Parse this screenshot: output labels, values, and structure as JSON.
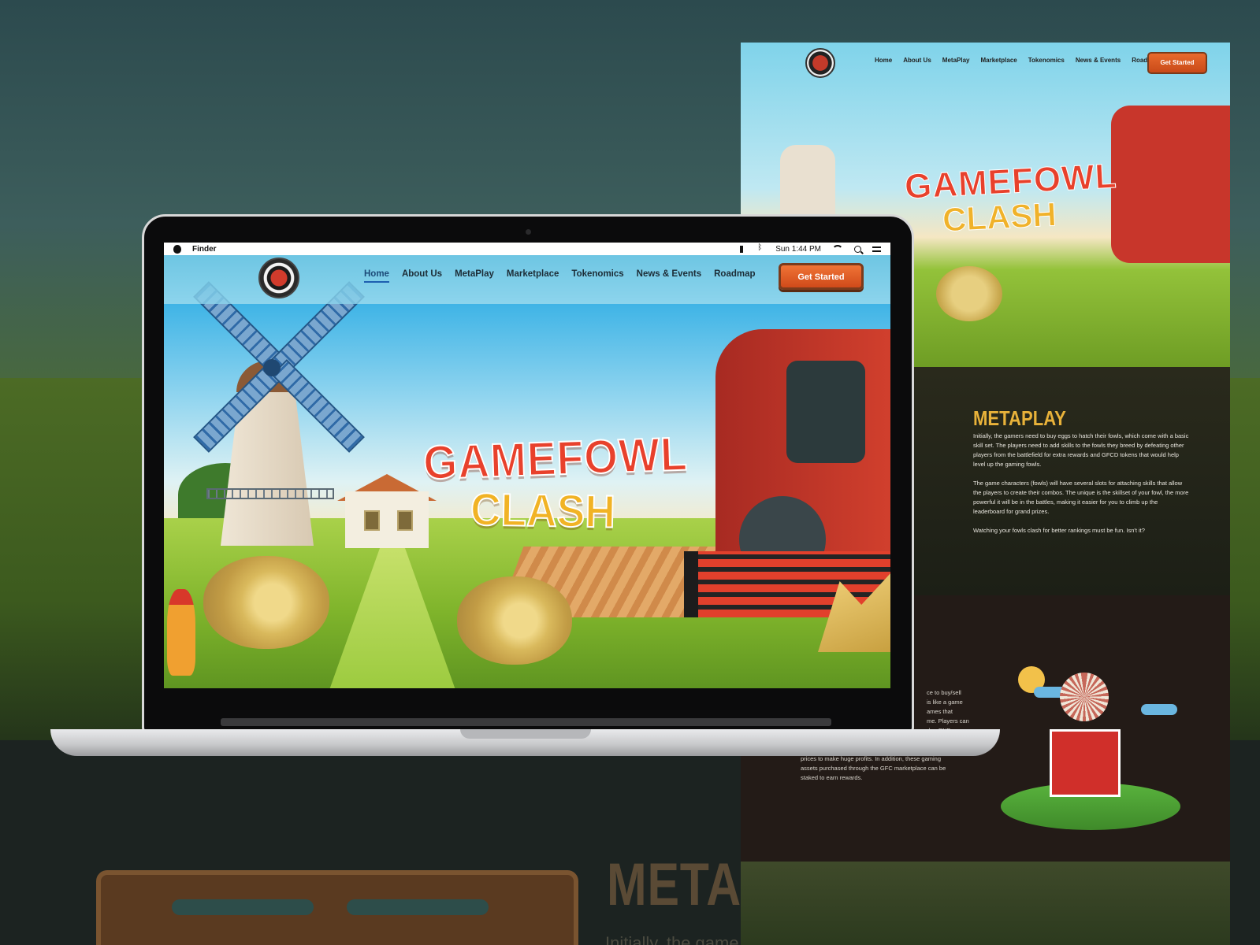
{
  "laptop": {
    "menubar": {
      "app_name": "Finder",
      "clock": "Sun 1:44 PM"
    },
    "site": {
      "nav": [
        {
          "label": "Home",
          "active": true
        },
        {
          "label": "About Us"
        },
        {
          "label": "MetaPlay"
        },
        {
          "label": "Marketplace"
        },
        {
          "label": "Tokenomics"
        },
        {
          "label": "News & Events"
        },
        {
          "label": "Roadmap"
        }
      ],
      "cta_label": "Get Started",
      "hero_title_line1": "GAMEFOWL",
      "hero_title_line2": "CLASH"
    }
  },
  "preview": {
    "nav": [
      "Home",
      "About Us",
      "MetaPlay",
      "Marketplace",
      "Tokenomics",
      "News & Events",
      "Roadmap"
    ],
    "cta_label": "Get Started",
    "hero_title_line1": "GAMEFOWL",
    "hero_title_line2": "CLASH",
    "metaplay": {
      "title": "METAPLAY",
      "paragraphs": [
        "Initially, the gamers need to buy eggs to hatch their fowls, which come with a basic skill set. The players need to add skills to the fowls they breed by defeating other players from the battlefield for extra rewards and GFCD tokens that would help level up the gaming fowls.",
        "The game characters (fowls) will have several slots for attaching skills that allow the players to create their combos. The unique is the skillset of your fowl, the more powerful it will be in the battles, making it easier for you to climb up the leaderboard for grand prizes.",
        "Watching your fowls clash for better rankings must be fun. Isn't it?"
      ]
    },
    "marketplace_text_fragments": [
      "ce to buy/sell",
      "is like a game",
      "ames that",
      "me. Players can",
      "d or BNB",
      "prices to make huge profits. In addition, these gaming",
      "assets purchased through the GFC marketplace can be",
      "staked to earn rewards."
    ]
  },
  "background": {
    "heading_fragment": "METAPL",
    "text_fragment": "Initially, the game"
  },
  "colors": {
    "title_red": "#e8412c",
    "title_gold": "#f1b325",
    "cta_orange": "#e0602a",
    "nav_active": "#1d5fb0"
  }
}
